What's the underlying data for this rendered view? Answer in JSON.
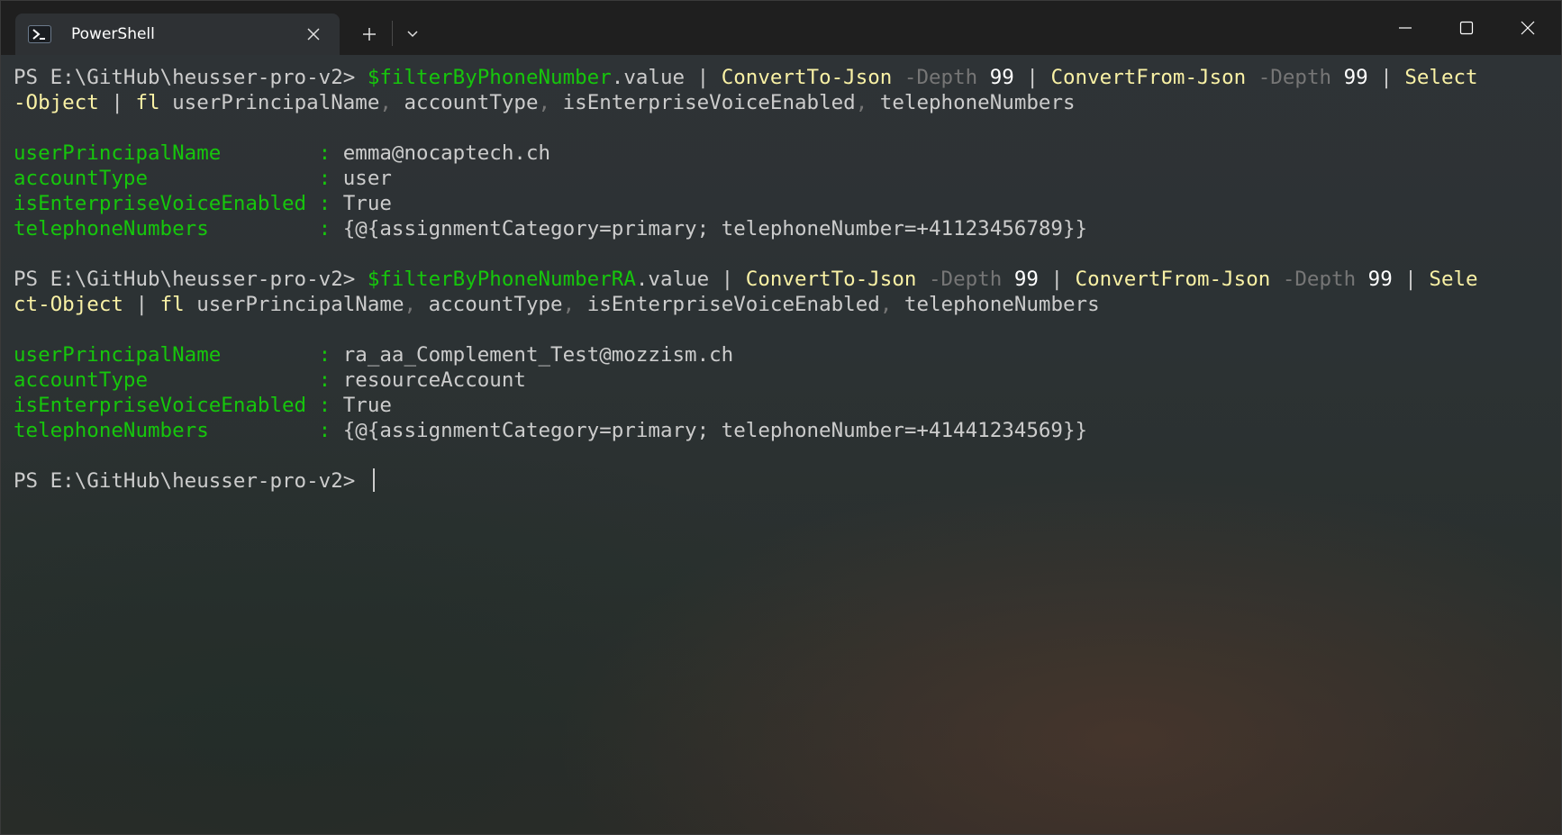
{
  "tab": {
    "title": "PowerShell",
    "icon": "powershell-icon"
  },
  "titlebar": {
    "new_tab_icon": "plus-icon",
    "dropdown_icon": "chevron-down-icon",
    "minimize_icon": "minimize-icon",
    "maximize_icon": "maximize-icon",
    "close_icon": "close-icon"
  },
  "colors": {
    "prompt_text": "#cccccc",
    "variable": "#16c60c",
    "command": "#f9f1a5",
    "parameter": "#767676",
    "number": "#ffffff",
    "property_label": "#16c60c"
  },
  "terminal": {
    "prompt": "PS E:\\GitHub\\heusser-pro-v2> ",
    "cmd1": {
      "line1": {
        "var": "$filterByPhoneNumber",
        "prop": ".value | ",
        "c1": "ConvertTo-Json",
        "p1": " -Depth ",
        "n1": "99",
        "pipe1": " | ",
        "c2": "ConvertFrom-Json",
        "p2": " -Depth ",
        "n2": "99",
        "pipe2": " | ",
        "c3": "Select"
      },
      "line2": {
        "c3": "-Object",
        "pipe": " | ",
        "c4": "fl",
        "a1": " userPrincipalName",
        "s1": ",",
        "a2": " accountType",
        "s2": ",",
        "a3": " isEnterpriseVoiceEnabled",
        "s3": ",",
        "a4": " telephoneNumbers"
      }
    },
    "out1": [
      {
        "label": "userPrincipalName        ",
        "sep": ": ",
        "value": "emma@nocaptech.ch"
      },
      {
        "label": "accountType              ",
        "sep": ": ",
        "value": "user"
      },
      {
        "label": "isEnterpriseVoiceEnabled ",
        "sep": ": ",
        "value": "True"
      },
      {
        "label": "telephoneNumbers         ",
        "sep": ": ",
        "value": "{@{assignmentCategory=primary; telephoneNumber=+41123456789}}"
      }
    ],
    "cmd2": {
      "line1": {
        "var": "$filterByPhoneNumberRA",
        "prop": ".value | ",
        "c1": "ConvertTo-Json",
        "p1": " -Depth ",
        "n1": "99",
        "pipe1": " | ",
        "c2": "ConvertFrom-Json",
        "p2": " -Depth ",
        "n2": "99",
        "pipe2": " | ",
        "c3": "Sele"
      },
      "line2": {
        "c3": "ct-Object",
        "pipe": " | ",
        "c4": "fl",
        "a1": " userPrincipalName",
        "s1": ",",
        "a2": " accountType",
        "s2": ",",
        "a3": " isEnterpriseVoiceEnabled",
        "s3": ",",
        "a4": " telephoneNumbers"
      }
    },
    "out2": [
      {
        "label": "userPrincipalName        ",
        "sep": ": ",
        "value": "ra_aa_Complement_Test@mozzism.ch"
      },
      {
        "label": "accountType              ",
        "sep": ": ",
        "value": "resourceAccount"
      },
      {
        "label": "isEnterpriseVoiceEnabled ",
        "sep": ": ",
        "value": "True"
      },
      {
        "label": "telephoneNumbers         ",
        "sep": ": ",
        "value": "{@{assignmentCategory=primary; telephoneNumber=+41441234569}}"
      }
    ]
  }
}
